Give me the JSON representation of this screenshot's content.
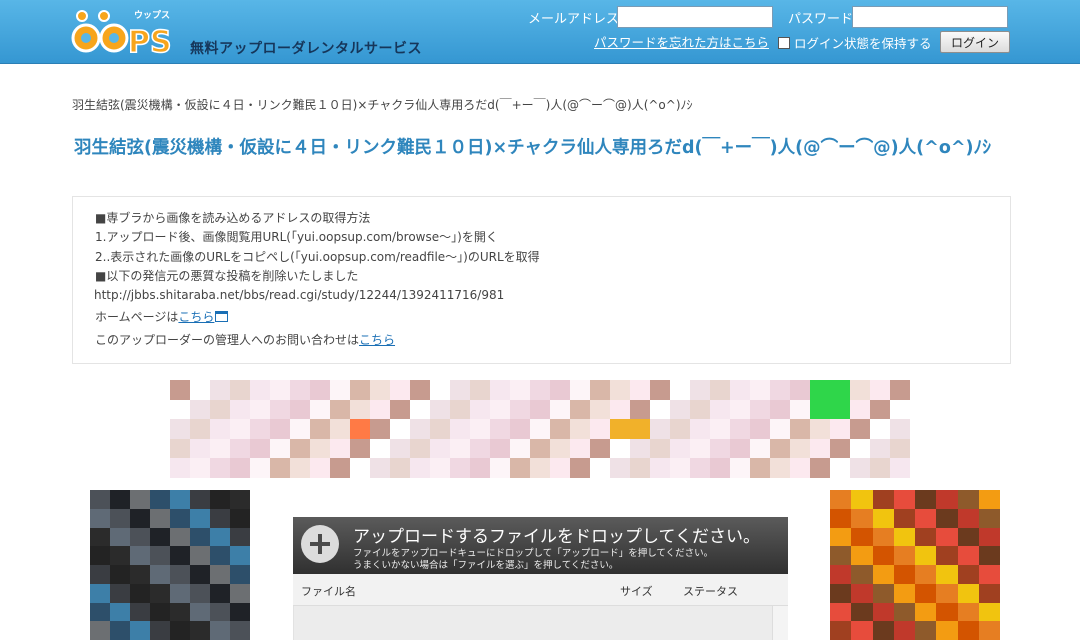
{
  "header": {
    "logo_text": "oops",
    "logo_sub": "ウップス",
    "tagline": "無料アップローダレンタルサービス",
    "email_label": "メールアドレス",
    "email_value": "",
    "password_label": "パスワード",
    "password_value": "",
    "forgot_link": "パスワードを忘れた方はこちら",
    "remember_label": "ログイン状態を保持する",
    "login_button": "ログイン"
  },
  "breadcrumb": "羽生結弦(震災機構・仮設に４日・リンク難民１０日)×チャクラ仙人専用ろだd(￣+ー￣)人(@⌒ー⌒@)人(^o^)ﾉｼ",
  "page_title": "羽生結弦(震災機構・仮設に４日・リンク難民１０日)×チャクラ仙人専用ろだd(￣+ー￣)人(@⌒ー⌒@)人(^o^)ﾉｼ",
  "info": {
    "line1": "■専ブラから画像を読み込めるアドレスの取得方法",
    "line2": "1.アップロード後、画像閲覧用URL(「yui.oopsup.com/browse～」)を開く",
    "line3": "2..表示された画像のURLをコピペし(「yui.oopsup.com/readfile～」)のURLを取得",
    "line4": "■以下の発信元の悪質な投稿を削除いたしました",
    "line5": "http://jbbs.shitaraba.net/bbs/read.cgi/study/12244/1392411716/981",
    "homepage_prefix": "ホームページは",
    "homepage_link": "こちら",
    "contact_prefix": "このアップローダーの管理人へのお問い合わせは",
    "contact_link": "こちら"
  },
  "uploader": {
    "drop_title": "アップロードするファイルをドロップしてください。",
    "drop_sub1": "ファイルをアップロードキューにドロップして「アップロード」を押してください。",
    "drop_sub2": "うまくいかない場合は「ファイルを選ぶ」を押してください。",
    "col_filename": "ファイル名",
    "col_size": "サイズ",
    "col_status": "ステータス"
  },
  "colors": {
    "header_top": "#58b6e7",
    "header_bottom": "#3597d2",
    "title_blue": "#2f86bd",
    "link_blue": "#1a6fb5"
  }
}
